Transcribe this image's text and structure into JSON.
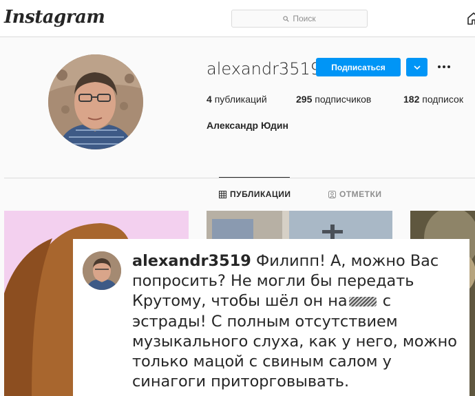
{
  "header": {
    "logo": "Instagram",
    "search_placeholder": "Поиск"
  },
  "profile": {
    "username": "alexandr3519",
    "follow_label": "Подписаться",
    "stats": {
      "posts_count": "4",
      "posts_label": "публикаций",
      "followers_count": "295",
      "followers_label": "подписчиков",
      "following_count": "182",
      "following_label": "подписок"
    },
    "full_name": "Александр Юдин"
  },
  "tabs": [
    {
      "label": "ПУБЛИКАЦИИ",
      "icon": "grid-icon",
      "active": true
    },
    {
      "label": "ОТМЕТКИ",
      "icon": "tag-person-icon",
      "active": false
    }
  ],
  "comment": {
    "user": "alexandr3519",
    "text_before": "Филипп! А, можно Вас попросить? Не могли бы передать Крутому, чтобы шёл он на",
    "text_after": "с эстрады! С полным отсутствием музыкального слуха, как у него, можно только мацой с свиным салом у синагоги приторговывать."
  },
  "colors": {
    "accent": "#0095f6",
    "border": "#dbdbdb",
    "text": "#262626",
    "muted": "#8e8e8e"
  }
}
